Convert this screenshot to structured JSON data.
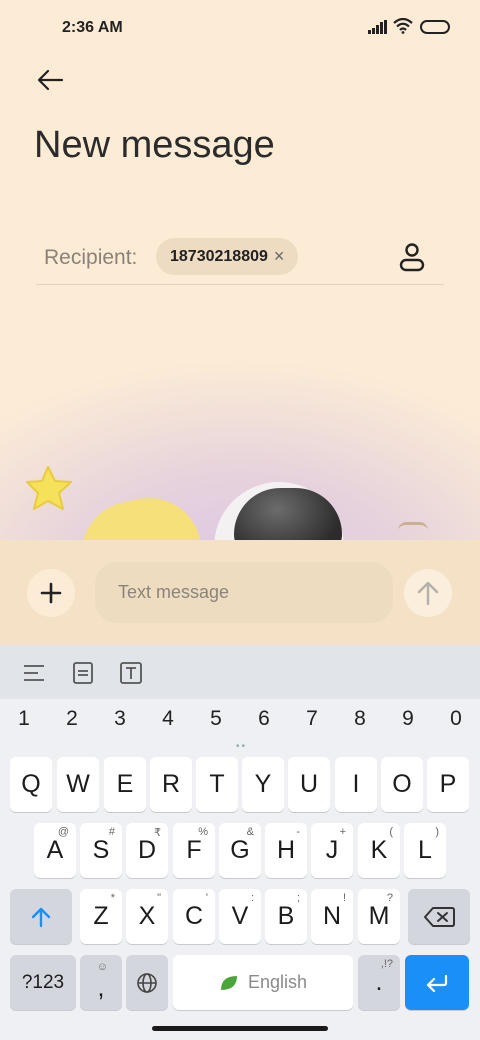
{
  "status": {
    "time": "2:36 AM"
  },
  "header": {
    "title": "New message"
  },
  "recipient": {
    "label": "Recipient:",
    "chip": "18730218809",
    "remove": "×"
  },
  "compose": {
    "placeholder": "Text message"
  },
  "keyboard": {
    "numbers": [
      "1",
      "2",
      "3",
      "4",
      "5",
      "6",
      "7",
      "8",
      "9",
      "0"
    ],
    "row1": [
      "Q",
      "W",
      "E",
      "R",
      "T",
      "Y",
      "U",
      "I",
      "O",
      "P"
    ],
    "row2": [
      "A",
      "S",
      "D",
      "F",
      "G",
      "H",
      "J",
      "K",
      "L"
    ],
    "row2_sup": [
      "@",
      "#",
      "₹",
      "%",
      "&",
      "-",
      "+",
      "(",
      ")"
    ],
    "row3": [
      "Z",
      "X",
      "C",
      "V",
      "B",
      "N",
      "M"
    ],
    "row3_sup": [
      "*",
      "\"",
      "'",
      ":",
      ";",
      "!",
      "?"
    ],
    "symbols": "?123",
    "comma": ",",
    "space": "English",
    "period": ".",
    "period_sup": ",!?"
  }
}
